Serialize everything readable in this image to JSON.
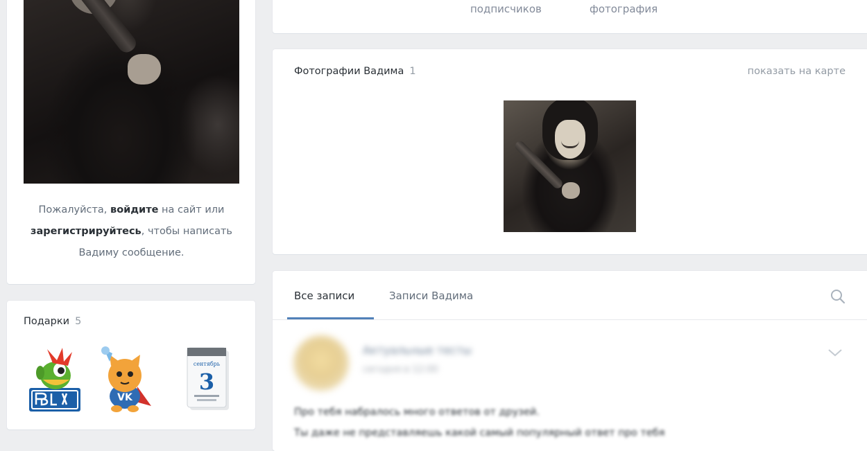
{
  "profile": {
    "login_prompt": {
      "before": "Пожалуйста, ",
      "login_link": "войдите",
      "middle": " на сайт или ",
      "register_link": "зарегистрируйтесь",
      "after": ", чтобы написать Вадиму сообщение."
    }
  },
  "gifts": {
    "title": "Подарки",
    "count": "5",
    "items": [
      {
        "icon": "murloc-blizzcon-gift-icon"
      },
      {
        "icon": "vk-cat-superhero-gift-icon"
      },
      {
        "icon": "calendar-september-3-gift-icon",
        "calendar_month": "сентябрь",
        "calendar_day": "3"
      }
    ]
  },
  "counters": {
    "followers_label": "подписчиков",
    "photos_label": "фотография"
  },
  "photos": {
    "title": "Фотографии Вадима",
    "count": "1",
    "map_link": "показать на карте"
  },
  "wall": {
    "tabs": [
      {
        "label": "Все записи",
        "active": true
      },
      {
        "label": "Записи Вадима",
        "active": false
      }
    ],
    "search_icon": "search-icon",
    "post": {
      "author": "Актуальные тесты",
      "date": "сегодня в 12:00",
      "text_line_1": "Про тебя набралось много ответов от друзей.",
      "text_line_2": "Ты даже не представляешь какой самый популярный ответ про тебя"
    }
  },
  "colors": {
    "page_background": "#edeef0",
    "card_background": "#ffffff",
    "accent": "#5181b8",
    "text_primary": "#2a3036",
    "text_secondary": "#828a99"
  }
}
